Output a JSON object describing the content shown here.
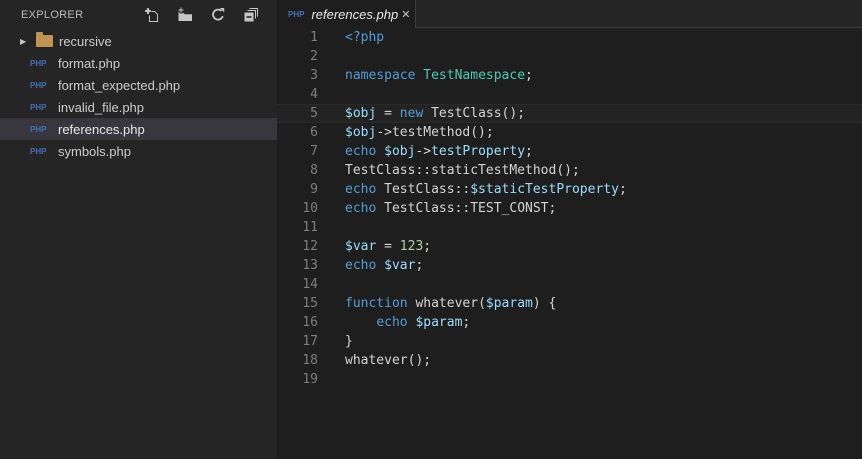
{
  "sidebar": {
    "title": "EXPLORER",
    "actions": [
      {
        "name": "new-file",
        "label": "New File"
      },
      {
        "name": "new-folder",
        "label": "New Folder"
      },
      {
        "name": "refresh",
        "label": "Refresh"
      },
      {
        "name": "collapse-all",
        "label": "Collapse All"
      }
    ],
    "chevron_glyph": "▶",
    "php_badge_text": "PHP",
    "files": [
      {
        "label": "recursive",
        "kind": "folder",
        "collapsed": true,
        "selected": false
      },
      {
        "label": "format.php",
        "kind": "php",
        "selected": false
      },
      {
        "label": "format_expected.php",
        "kind": "php",
        "selected": false
      },
      {
        "label": "invalid_file.php",
        "kind": "php",
        "selected": false
      },
      {
        "label": "references.php",
        "kind": "php",
        "selected": true
      },
      {
        "label": "symbols.php",
        "kind": "php",
        "selected": false
      }
    ]
  },
  "editor": {
    "tab": {
      "label": "references.php",
      "icon": "php",
      "close_glyph": "✕",
      "preview": true
    },
    "language": "php",
    "current_line": 5,
    "lines": [
      {
        "n": 1,
        "tokens": [
          {
            "c": "kw",
            "t": "<?php"
          }
        ]
      },
      {
        "n": 2,
        "tokens": []
      },
      {
        "n": 3,
        "tokens": [
          {
            "c": "kw",
            "t": "namespace"
          },
          {
            "c": "pl",
            "t": " "
          },
          {
            "c": "cl",
            "t": "TestNamespace"
          },
          {
            "c": "pl",
            "t": ";"
          }
        ]
      },
      {
        "n": 4,
        "tokens": []
      },
      {
        "n": 5,
        "tokens": [
          {
            "c": "va",
            "t": "$obj"
          },
          {
            "c": "pl",
            "t": " = "
          },
          {
            "c": "kw",
            "t": "new"
          },
          {
            "c": "pl",
            "t": " TestClass();"
          }
        ]
      },
      {
        "n": 6,
        "tokens": [
          {
            "c": "va",
            "t": "$obj"
          },
          {
            "c": "pl",
            "t": "->testMethod();"
          }
        ]
      },
      {
        "n": 7,
        "tokens": [
          {
            "c": "kw",
            "t": "echo"
          },
          {
            "c": "pl",
            "t": " "
          },
          {
            "c": "va",
            "t": "$obj"
          },
          {
            "c": "pl",
            "t": "->"
          },
          {
            "c": "va",
            "t": "testProperty"
          },
          {
            "c": "pl",
            "t": ";"
          }
        ]
      },
      {
        "n": 8,
        "tokens": [
          {
            "c": "pl",
            "t": "TestClass::staticTestMethod();"
          }
        ]
      },
      {
        "n": 9,
        "tokens": [
          {
            "c": "kw",
            "t": "echo"
          },
          {
            "c": "pl",
            "t": " TestClass::"
          },
          {
            "c": "va",
            "t": "$staticTestProperty"
          },
          {
            "c": "pl",
            "t": ";"
          }
        ]
      },
      {
        "n": 10,
        "tokens": [
          {
            "c": "kw",
            "t": "echo"
          },
          {
            "c": "pl",
            "t": " TestClass::TEST_CONST;"
          }
        ]
      },
      {
        "n": 11,
        "tokens": []
      },
      {
        "n": 12,
        "tokens": [
          {
            "c": "va",
            "t": "$var"
          },
          {
            "c": "pl",
            "t": " = "
          },
          {
            "c": "nu",
            "t": "123"
          },
          {
            "c": "pl",
            "t": ";"
          }
        ]
      },
      {
        "n": 13,
        "tokens": [
          {
            "c": "kw",
            "t": "echo"
          },
          {
            "c": "pl",
            "t": " "
          },
          {
            "c": "va",
            "t": "$var"
          },
          {
            "c": "pl",
            "t": ";"
          }
        ]
      },
      {
        "n": 14,
        "tokens": []
      },
      {
        "n": 15,
        "tokens": [
          {
            "c": "kw",
            "t": "function"
          },
          {
            "c": "pl",
            "t": " whatever("
          },
          {
            "c": "va",
            "t": "$param"
          },
          {
            "c": "pl",
            "t": ") {"
          }
        ]
      },
      {
        "n": 16,
        "tokens": [
          {
            "c": "pl",
            "t": "    "
          },
          {
            "c": "kw",
            "t": "echo"
          },
          {
            "c": "pl",
            "t": " "
          },
          {
            "c": "va",
            "t": "$param"
          },
          {
            "c": "pl",
            "t": ";"
          }
        ]
      },
      {
        "n": 17,
        "tokens": [
          {
            "c": "pl",
            "t": "}"
          }
        ]
      },
      {
        "n": 18,
        "tokens": [
          {
            "c": "pl",
            "t": "whatever();"
          }
        ]
      },
      {
        "n": 19,
        "tokens": []
      }
    ]
  },
  "colors": {
    "editor_bg": "#1E1E1E",
    "sidebar_bg": "#252526",
    "tab_strip_bg": "#252526",
    "border": "#3C3C3C",
    "selected_row_bg": "#37373D",
    "current_line_bg": "#232323",
    "title": "#BBBBBB",
    "label": "#CCCCCC",
    "icon": "#C5C5C5",
    "line_number": "#7E7E7E",
    "php_badge": "#4272B5",
    "folder": "#C09553",
    "keyword": "#569CD6",
    "variable": "#9CDCFE",
    "class_name": "#4EC9B0",
    "number": "#B5CEA8",
    "plain": "#D4D4D4"
  }
}
